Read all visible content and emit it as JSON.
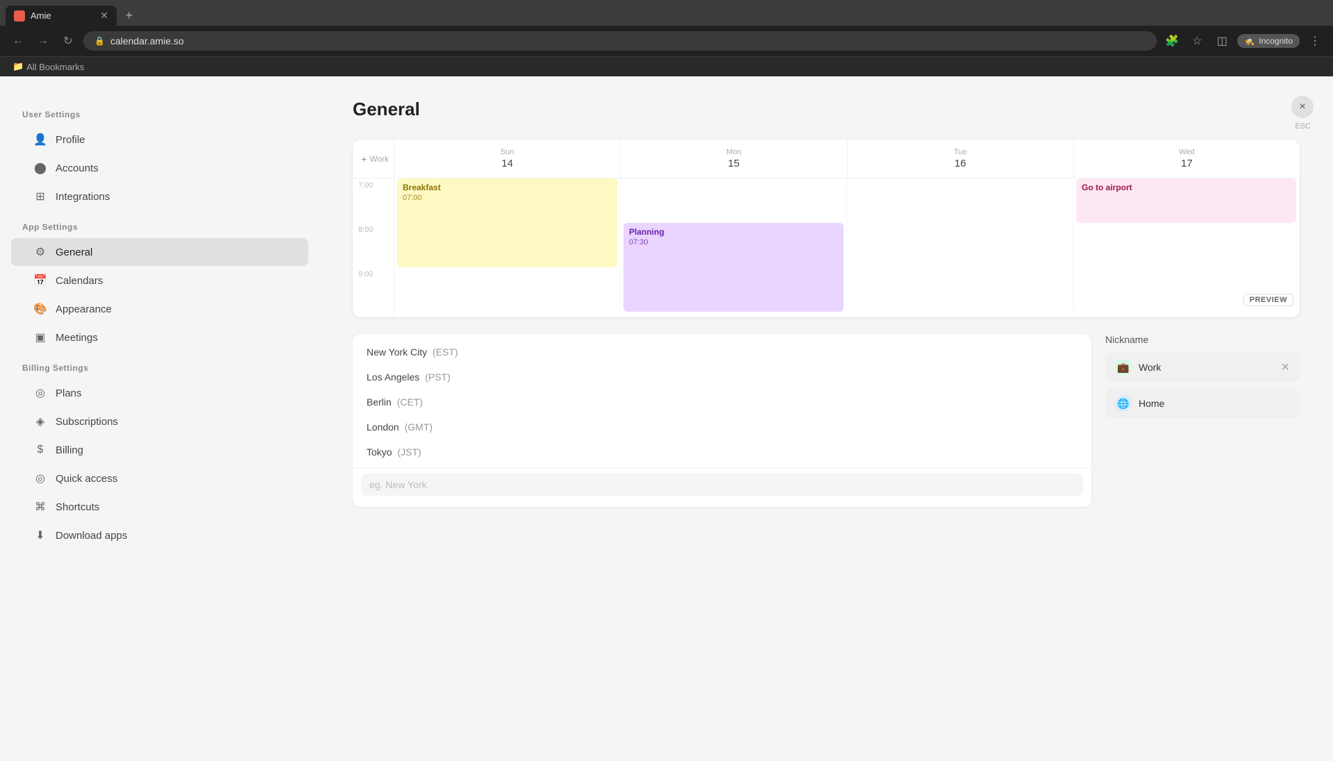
{
  "browser": {
    "tab": {
      "title": "Amie",
      "favicon_color": "#e85d4a"
    },
    "address": "calendar.amie.so",
    "incognito_label": "Incognito",
    "bookmarks_label": "All Bookmarks"
  },
  "sidebar": {
    "user_settings_label": "User Settings",
    "app_settings_label": "App Settings",
    "billing_settings_label": "Billing Settings",
    "items": {
      "profile": "Profile",
      "accounts": "Accounts",
      "integrations": "Integrations",
      "general": "General",
      "calendars": "Calendars",
      "appearance": "Appearance",
      "meetings": "Meetings",
      "plans": "Plans",
      "subscriptions": "Subscriptions",
      "billing": "Billing",
      "quick_access": "Quick access",
      "shortcuts": "Shortcuts",
      "download_apps": "Download apps"
    }
  },
  "main": {
    "title": "General",
    "close_button": "×",
    "esc_label": "ESC"
  },
  "calendar": {
    "days": [
      {
        "name": "Sun",
        "num": "14"
      },
      {
        "name": "Mon",
        "num": "15"
      },
      {
        "name": "Tue",
        "num": "16"
      },
      {
        "name": "Wed",
        "num": "17"
      }
    ],
    "times": [
      "7:00",
      "8:00",
      "9:00"
    ],
    "corner_label": "Work",
    "events": {
      "breakfast": {
        "title": "Breakfast",
        "time": "07:00"
      },
      "planning": {
        "title": "Planning",
        "time": "07:30"
      },
      "airport": {
        "title": "Go to airport",
        "time": ""
      }
    },
    "preview_badge": "PREVIEW"
  },
  "timezones": {
    "items": [
      {
        "city": "New York City",
        "tz": "(EST)"
      },
      {
        "city": "Los Angeles",
        "tz": "(PST)"
      },
      {
        "city": "Berlin",
        "tz": "(CET)"
      },
      {
        "city": "London",
        "tz": "(GMT)"
      },
      {
        "city": "Tokyo",
        "tz": "(JST)"
      }
    ],
    "input_placeholder": "eg. New York"
  },
  "nickname": {
    "label": "Nickname",
    "items": [
      {
        "icon": "💼",
        "name": "Work"
      },
      {
        "icon": "🌐",
        "name": "Home"
      }
    ]
  }
}
